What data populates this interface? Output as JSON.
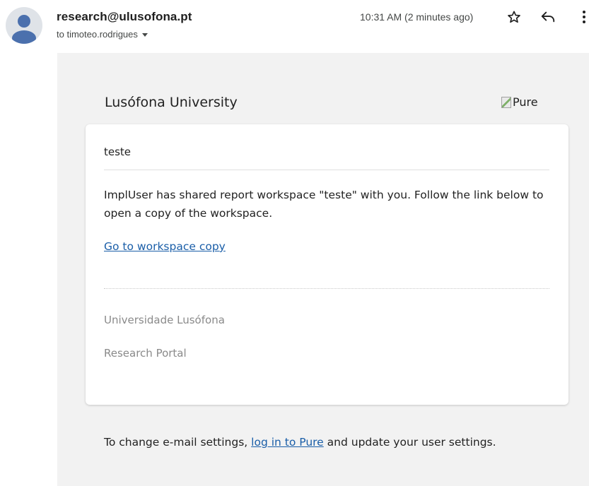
{
  "header": {
    "sender": "research@ulusofona.pt",
    "recipient": "to timoteo.rodrigues",
    "timestamp": "10:31 AM (2 minutes ago)",
    "icons": [
      "avatar",
      "caret-down-icon",
      "star-icon",
      "reply-icon",
      "more-vert-icon"
    ]
  },
  "email": {
    "org_name": "Lusófona University",
    "logo_alt": "Pure",
    "subject": "teste",
    "message": "ImplUser has shared report workspace \"teste\" with you. Follow the link below to open a copy of the workspace.",
    "link_label": "Go to workspace copy",
    "footer_line_1": "Universidade Lusófona",
    "footer_line_2": "Research Portal",
    "settings_prefix": "To change e-mail settings, ",
    "settings_link": "log in to Pure",
    "settings_suffix": " and update your user settings."
  },
  "colors": {
    "panel_bg": "#f2f2f2",
    "link": "#1a5ea8",
    "muted_text": "#8a8a8a"
  }
}
